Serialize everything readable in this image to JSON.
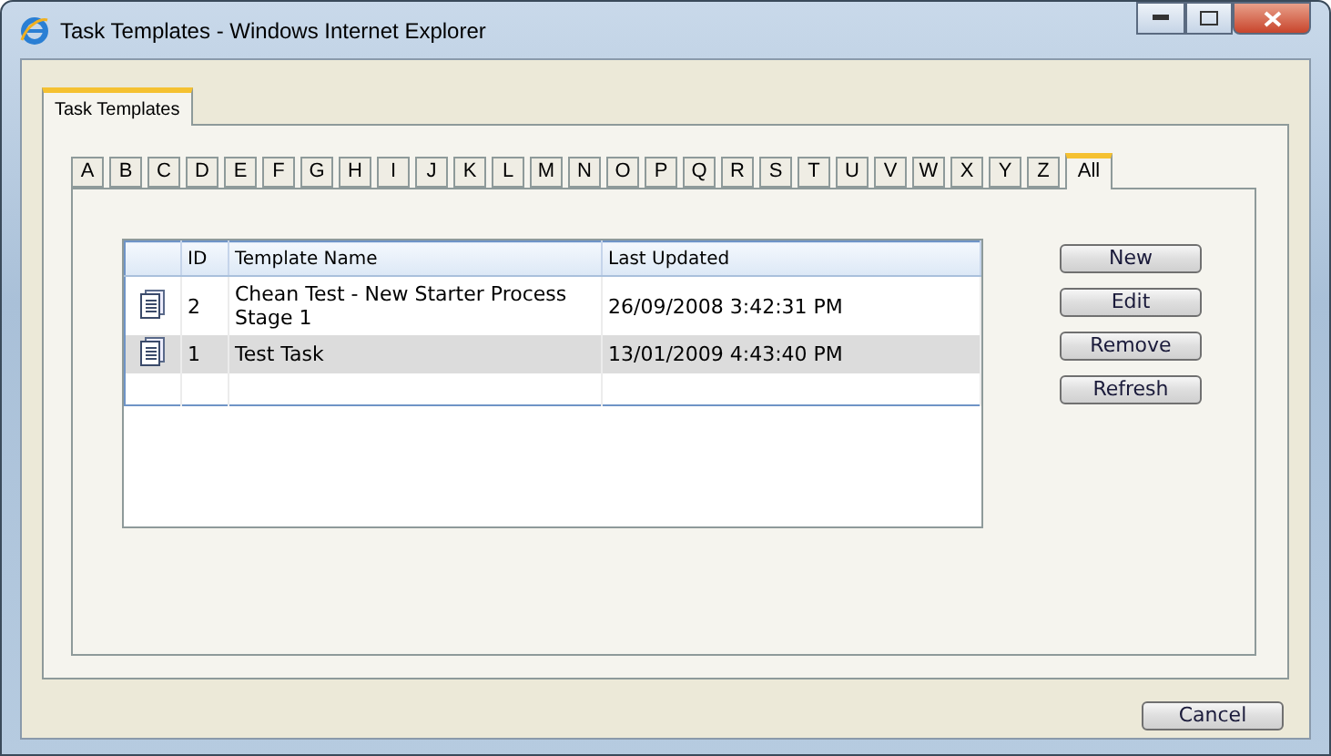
{
  "window": {
    "title": "Task Templates - Windows Internet Explorer"
  },
  "outer_tabs": [
    {
      "label": "Task Templates",
      "selected": true
    }
  ],
  "letter_tabs": [
    {
      "label": "A",
      "selected": false
    },
    {
      "label": "B",
      "selected": false
    },
    {
      "label": "C",
      "selected": false
    },
    {
      "label": "D",
      "selected": false
    },
    {
      "label": "E",
      "selected": false
    },
    {
      "label": "F",
      "selected": false
    },
    {
      "label": "G",
      "selected": false
    },
    {
      "label": "H",
      "selected": false
    },
    {
      "label": "I",
      "selected": false
    },
    {
      "label": "J",
      "selected": false
    },
    {
      "label": "K",
      "selected": false
    },
    {
      "label": "L",
      "selected": false
    },
    {
      "label": "M",
      "selected": false
    },
    {
      "label": "N",
      "selected": false
    },
    {
      "label": "O",
      "selected": false
    },
    {
      "label": "P",
      "selected": false
    },
    {
      "label": "Q",
      "selected": false
    },
    {
      "label": "R",
      "selected": false
    },
    {
      "label": "S",
      "selected": false
    },
    {
      "label": "T",
      "selected": false
    },
    {
      "label": "U",
      "selected": false
    },
    {
      "label": "V",
      "selected": false
    },
    {
      "label": "W",
      "selected": false
    },
    {
      "label": "X",
      "selected": false
    },
    {
      "label": "Y",
      "selected": false
    },
    {
      "label": "Z",
      "selected": false
    },
    {
      "label": "All",
      "selected": true
    }
  ],
  "table": {
    "columns": [
      "ID",
      "Template Name",
      "Last Updated"
    ],
    "rows": [
      {
        "id": "2",
        "name": "Chean Test - New Starter Process Stage 1",
        "updated": "26/09/2008 3:42:31 PM",
        "selected": false
      },
      {
        "id": "1",
        "name": "Test Task",
        "updated": "13/01/2009 4:43:40 PM",
        "selected": true
      }
    ]
  },
  "actions": [
    "New",
    "Edit",
    "Remove",
    "Refresh"
  ],
  "footer_buttons": [
    "Cancel"
  ]
}
